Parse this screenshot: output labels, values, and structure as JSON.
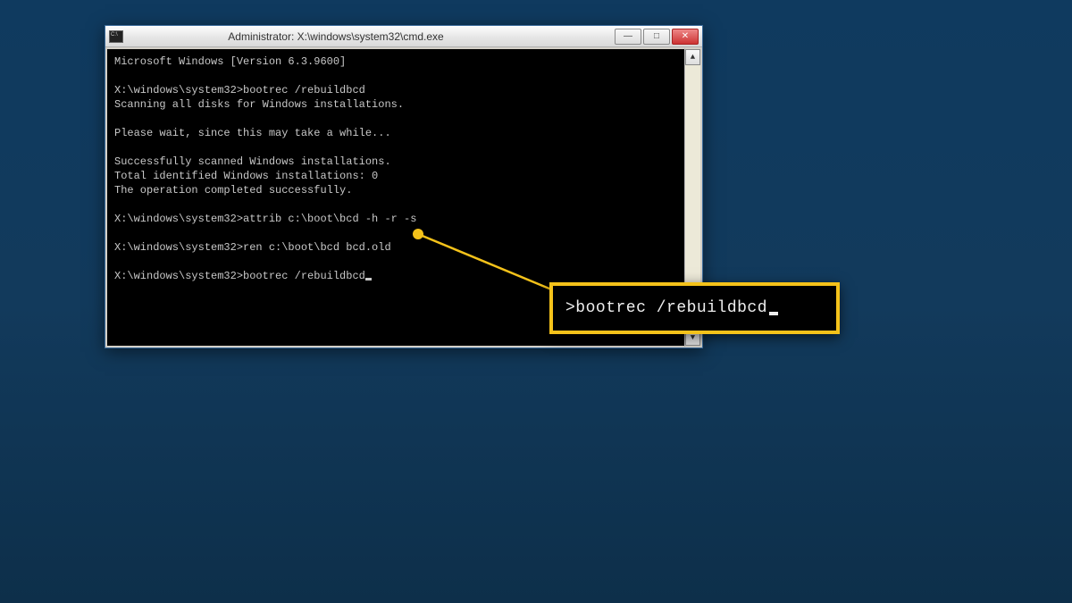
{
  "window": {
    "title": "Administrator: X:\\windows\\system32\\cmd.exe",
    "controls": {
      "minimize": "—",
      "maximize": "□",
      "close": "✕"
    }
  },
  "terminal": {
    "lines": [
      "Microsoft Windows [Version 6.3.9600]",
      "",
      "X:\\windows\\system32>bootrec /rebuildbcd",
      "Scanning all disks for Windows installations.",
      "",
      "Please wait, since this may take a while...",
      "",
      "Successfully scanned Windows installations.",
      "Total identified Windows installations: 0",
      "The operation completed successfully.",
      "",
      "X:\\windows\\system32>attrib c:\\boot\\bcd -h -r -s",
      "",
      "X:\\windows\\system32>ren c:\\boot\\bcd bcd.old",
      "",
      "X:\\windows\\system32>bootrec /rebuildbcd"
    ]
  },
  "scrollbar": {
    "up": "▲",
    "down": "▼"
  },
  "callout": {
    "text": ">bootrec /rebuildbcd"
  }
}
